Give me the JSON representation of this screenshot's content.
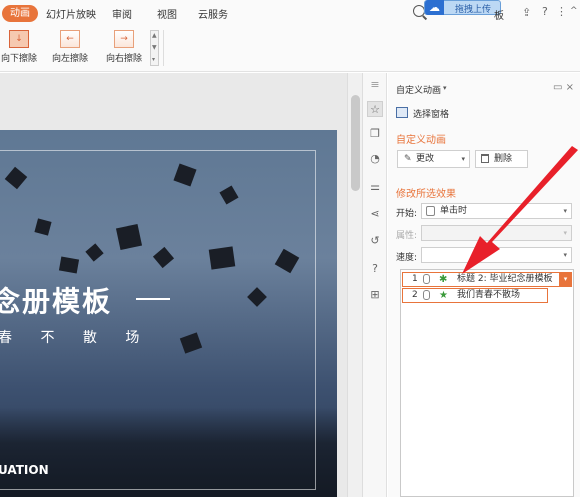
{
  "menu": {
    "tabs": [
      {
        "label": "动画",
        "active": true
      },
      {
        "label": "幻灯片放映"
      },
      {
        "label": "审阅"
      },
      {
        "label": "视图"
      },
      {
        "label": "云服务"
      }
    ],
    "upload_badge": "拖拽上传",
    "plate_text": "板"
  },
  "ribbon": {
    "items": [
      {
        "label": "向下擦除",
        "icon": "arrow-down-icon",
        "glyph": "↓"
      },
      {
        "label": "向左擦除",
        "icon": "arrow-left-icon",
        "glyph": "←"
      },
      {
        "label": "向右擦除",
        "icon": "arrow-right-icon",
        "glyph": "→"
      }
    ]
  },
  "slide": {
    "title": "念册模板",
    "subtitle": "春 不 散 场",
    "english": "UATION"
  },
  "pane": {
    "title": "自定义动画",
    "selection_pane": "选择窗格",
    "section_custom": "自定义动画",
    "change_button": "更改",
    "delete_button": "删除",
    "section_modify": "修改所选效果",
    "start_label": "开始:",
    "start_value": "单击时",
    "property_label": "属性:",
    "property_value": "",
    "speed_label": "速度:",
    "speed_value": "",
    "list": [
      {
        "num": "1",
        "text": "标题 2: 毕业纪念册模板",
        "star_color": "#3a9a3a"
      },
      {
        "num": "2",
        "text": "我们青春不散场",
        "star_color": "#3a9a3a"
      }
    ]
  },
  "colors": {
    "accent": "#e8743b",
    "annotation": "#e8202a"
  }
}
